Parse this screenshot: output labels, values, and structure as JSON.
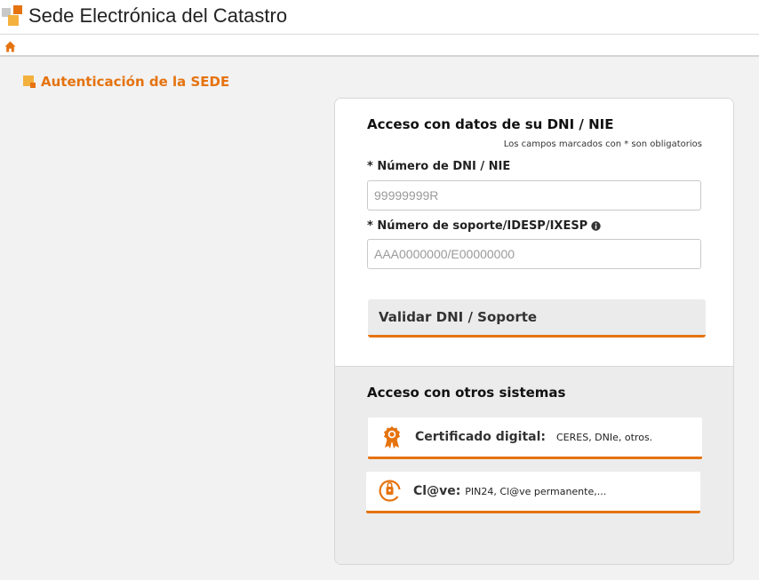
{
  "header": {
    "site_title": "Sede Electrónica del Catastro",
    "logo_icon": "catastro-logo-icon",
    "home_icon": "home-icon"
  },
  "colors": {
    "accent": "#e5730f",
    "accent_light": "#f4b13e",
    "page_background": "#f2f2f2",
    "panel_grey": "#ececec"
  },
  "section": {
    "title": "Autenticación de la SEDE"
  },
  "dni_access": {
    "heading": "Acceso con datos de su DNI / NIE",
    "required_note": "Los campos marcados con * son obligatorios",
    "dni_label": "* Número de DNI / NIE",
    "dni_value": "",
    "dni_placeholder": "99999999R",
    "support_label": "* Número de soporte/IDESP/IXESP",
    "support_info_icon": "info-icon",
    "support_value": "",
    "support_placeholder": "AAA0000000/E00000000",
    "validate_button": "Validar DNI / Soporte"
  },
  "other_access": {
    "heading": "Acceso con otros sistemas",
    "options": [
      {
        "icon": "certificate-award-icon",
        "title": "Certificado digital:",
        "description": "CERES, DNIe, otros."
      },
      {
        "icon": "clave-at-icon",
        "title": "Cl@ve:",
        "description": "PIN24, Cl@ve permanente,..."
      }
    ]
  }
}
